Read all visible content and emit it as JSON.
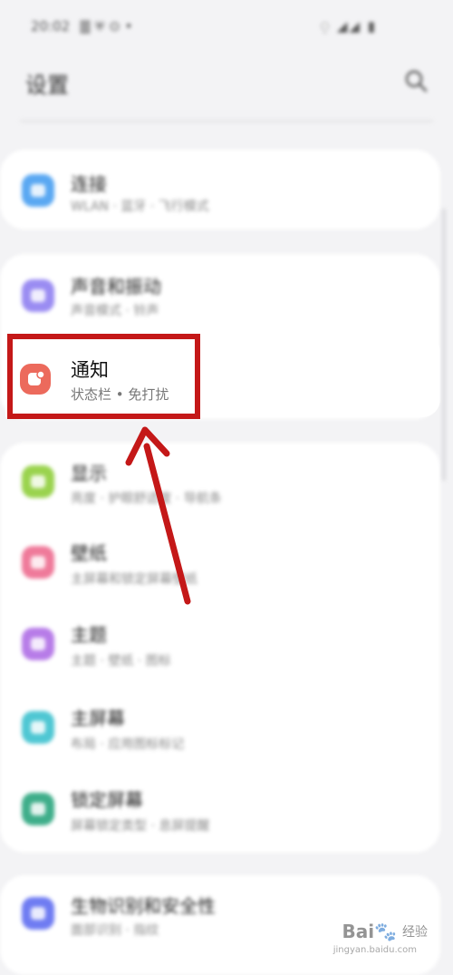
{
  "status_bar": {
    "time": "20:02",
    "left_icons": "🀫 ⛨ ⊙ •",
    "right_icons": "⍜ ◢◢ ▮"
  },
  "header": {
    "title": "设置"
  },
  "groups": [
    {
      "items": [
        {
          "title": "连接",
          "subtitle": "WLAN · 蓝牙 · 飞行模式",
          "color": "#5aa8f2"
        }
      ]
    },
    {
      "items": [
        {
          "title": "声音和振动",
          "subtitle": "声音模式 · 铃声",
          "color": "#9a8cf2"
        },
        {
          "title": "通知",
          "subtitle": "状态栏 • 免打扰",
          "color": "#ec6a5c"
        }
      ]
    },
    {
      "items": [
        {
          "title": "显示",
          "subtitle": "亮度 · 护眼舒适度 · 导航条",
          "color": "#9ad34e"
        },
        {
          "title": "壁纸",
          "subtitle": "主屏幕和锁定屏幕壁纸",
          "color": "#ef7a9a"
        },
        {
          "title": "主题",
          "subtitle": "主题 · 壁纸 · 图标",
          "color": "#b77ce8"
        },
        {
          "title": "主屏幕",
          "subtitle": "布局 · 应用图标标记",
          "color": "#4fc7d3"
        },
        {
          "title": "锁定屏幕",
          "subtitle": "屏幕锁定类型 · 息屏提醒",
          "color": "#3fae8a"
        }
      ]
    },
    {
      "items": [
        {
          "title": "生物识别和安全性",
          "subtitle": "面部识别 · 指纹",
          "color": "#6f7cf2"
        }
      ]
    }
  ],
  "highlight_color": "#c41818",
  "watermark": {
    "logo": "Bai🐾",
    "text": "经验",
    "url": "jingyan.baidu.com"
  }
}
